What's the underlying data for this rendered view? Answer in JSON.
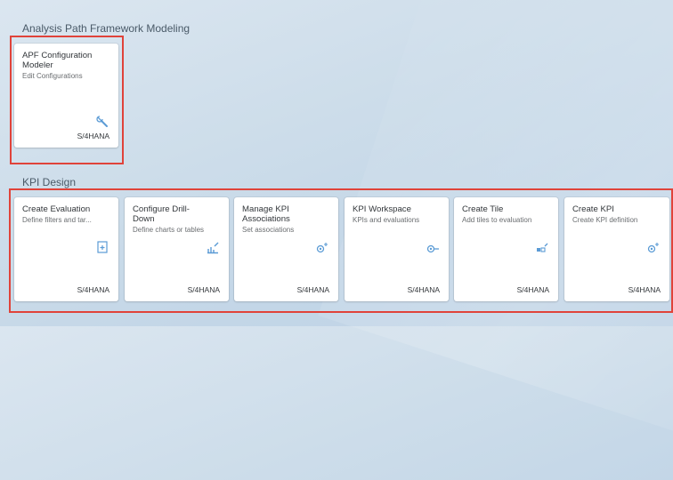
{
  "groups": [
    {
      "title": "Analysis Path Framework Modeling",
      "tiles": [
        {
          "title_lines": [
            "APF Configuration",
            "Modeler"
          ],
          "subtitle": "Edit Configurations",
          "icon": "wrench-icon",
          "footer": "S/4HANA"
        }
      ]
    },
    {
      "title": "KPI Design",
      "tiles": [
        {
          "title_lines": [
            "Create Evaluation"
          ],
          "subtitle": "Define filters and tar...",
          "icon": "document-add-icon",
          "footer": "S/4HANA"
        },
        {
          "title_lines": [
            "Configure Drill-",
            "Down"
          ],
          "subtitle": "Define charts or tables",
          "icon": "bar-chart-edit-icon",
          "footer": "S/4HANA"
        },
        {
          "title_lines": [
            "Manage KPI",
            "Associations"
          ],
          "subtitle": "Set associations",
          "icon": "kpi-associations-icon",
          "footer": "S/4HANA"
        },
        {
          "title_lines": [
            "KPI Workspace"
          ],
          "subtitle": "KPIs and evaluations",
          "icon": "kpi-workspace-icon",
          "footer": "S/4HANA"
        },
        {
          "title_lines": [
            "Create Tile"
          ],
          "subtitle": "Add tiles to evaluation",
          "icon": "create-tile-icon",
          "footer": "S/4HANA"
        },
        {
          "title_lines": [
            "Create KPI"
          ],
          "subtitle": "Create KPI definition",
          "icon": "create-kpi-icon",
          "footer": "S/4HANA"
        }
      ]
    }
  ],
  "colors": {
    "highlight": "#e0433a",
    "icon": "#5b9bd5"
  }
}
